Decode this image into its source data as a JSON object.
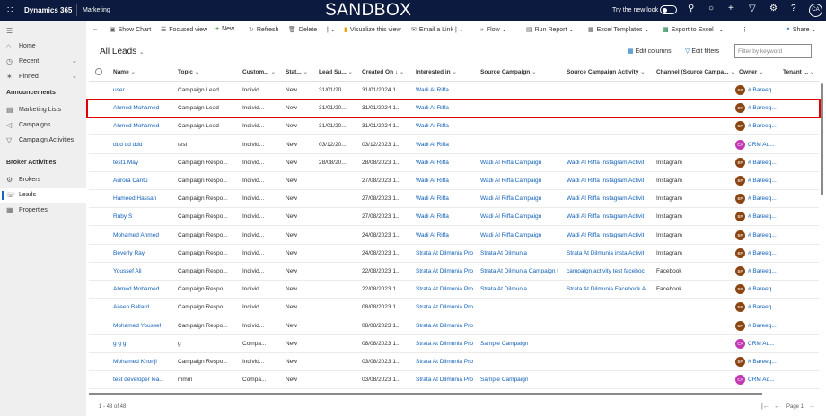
{
  "topbar": {
    "brand": "Dynamics 365",
    "app": "Marketing",
    "environment": "SANDBOX",
    "new_look_label": "Try the new look",
    "new_look_on": false,
    "user_initials": "CA",
    "bg_color": "#0b1a3e"
  },
  "sidebar": {
    "top_items": [
      {
        "label": "Home",
        "icon": "home-icon"
      },
      {
        "label": "Recent",
        "icon": "clock-icon"
      },
      {
        "label": "Pinned",
        "icon": "pin-icon"
      }
    ],
    "groups": [
      {
        "title": "Announcements",
        "items": [
          {
            "label": "Marketing Lists"
          },
          {
            "label": "Campaigns"
          },
          {
            "label": "Campaign Activities"
          }
        ]
      },
      {
        "title": "Broker Activities",
        "items": [
          {
            "label": "Brokers"
          },
          {
            "label": "Leads",
            "active": true
          },
          {
            "label": "Properties"
          }
        ]
      }
    ]
  },
  "commands": {
    "show_chart": "Show Chart",
    "focused_view": "Focused view",
    "new": "New",
    "refresh": "Refresh",
    "delete": "Delete",
    "visualize": "Visualize this view",
    "email_link": "Email a Link",
    "flow": "Flow",
    "run_report": "Run Report",
    "excel_templates": "Excel Templates",
    "export_excel": "Export to Excel",
    "share": "Share"
  },
  "view": {
    "title": "All Leads",
    "edit_columns": "Edit columns",
    "edit_filters": "Edit filters",
    "filter_placeholder": "Filter by keyword"
  },
  "columns": [
    "Name",
    "Topic",
    "Custom...",
    "Stat...",
    "Lead Su...",
    "Created On",
    "Interested in",
    "Source Campaign",
    "Source Campaign Activity",
    "Channel (Source Campa...",
    "Owner",
    "Tenant ..."
  ],
  "rows": [
    {
      "name": "user",
      "topic": "Campaign Lead",
      "customer": "Individ...",
      "status": "New",
      "lead_source": "31/01/20...",
      "created": "31/01/2024 1...",
      "interested": "Wadi Al Riffa",
      "campaign": "",
      "activity": "",
      "channel": "",
      "owner_initials": "BP",
      "owner": "# Bareeq..."
    },
    {
      "name": "Ahmed Mohamed",
      "topic": "Campaign Lead",
      "customer": "Individ...",
      "status": "New",
      "lead_source": "31/01/20...",
      "created": "31/01/2024 1...",
      "interested": "Wadi Al Riffa",
      "campaign": "",
      "activity": "",
      "channel": "",
      "owner_initials": "BP",
      "owner": "# Bareeq...",
      "highlighted": true
    },
    {
      "name": "Ahmed Mohamed",
      "topic": "Campaign Lead",
      "customer": "Individ...",
      "status": "New",
      "lead_source": "31/01/20...",
      "created": "31/01/2024 1...",
      "interested": "Wadi Al Riffa",
      "campaign": "",
      "activity": "",
      "channel": "",
      "owner_initials": "BP",
      "owner": "# Bareeq..."
    },
    {
      "name": "ddd dd ddd",
      "topic": "test",
      "customer": "Individ...",
      "status": "New",
      "lead_source": "03/12/20...",
      "created": "03/12/2023 1...",
      "interested": "Wadi Al Riffa",
      "campaign": "",
      "activity": "",
      "channel": "",
      "owner_initials": "CA",
      "owner": "CRM Ad..."
    },
    {
      "name": "test1 May",
      "topic": "Campaign Respo...",
      "customer": "Individ...",
      "status": "New",
      "lead_source": "28/08/20...",
      "created": "28/08/2023 1...",
      "interested": "Wadi Al Riffa",
      "campaign": "Wadi Al Riffa Campaign",
      "activity": "Wadi Al Riffa Instagram Activit",
      "channel": "Instagram",
      "owner_initials": "BP",
      "owner": "# Bareeq..."
    },
    {
      "name": "Aurora Cantu",
      "topic": "Campaign Respo...",
      "customer": "Individ...",
      "status": "New",
      "lead_source": "",
      "created": "27/08/2023 1...",
      "interested": "Wadi Al Riffa",
      "campaign": "Wadi Al Riffa Campaign",
      "activity": "Wadi Al Riffa Instagram Activit",
      "channel": "Instagram",
      "owner_initials": "BP",
      "owner": "# Bareeq..."
    },
    {
      "name": "Hameed Hassan",
      "topic": "Campaign Respo...",
      "customer": "Individ...",
      "status": "New",
      "lead_source": "",
      "created": "27/08/2023 1...",
      "interested": "Wadi Al Riffa",
      "campaign": "Wadi Al Riffa Campaign",
      "activity": "Wadi Al Riffa Instagram Activit",
      "channel": "Instagram",
      "owner_initials": "BP",
      "owner": "# Bareeq..."
    },
    {
      "name": "Ruby S",
      "topic": "Campaign Respo...",
      "customer": "Individ...",
      "status": "New",
      "lead_source": "",
      "created": "27/08/2023 1...",
      "interested": "Wadi Al Riffa",
      "campaign": "Wadi Al Riffa Campaign",
      "activity": "Wadi Al Riffa Instagram Activit",
      "channel": "Instagram",
      "owner_initials": "BP",
      "owner": "# Bareeq..."
    },
    {
      "name": "Mohamed Ahmed",
      "topic": "Campaign Respo...",
      "customer": "Individ...",
      "status": "New",
      "lead_source": "",
      "created": "24/08/2023 1...",
      "interested": "Wadi Al Riffa",
      "campaign": "Wadi Al Riffa Campaign",
      "activity": "Wadi Al Riffa Instagram Activit",
      "channel": "Instagram",
      "owner_initials": "BP",
      "owner": "# Bareeq..."
    },
    {
      "name": "Beverly Ray",
      "topic": "Campaign Respo...",
      "customer": "Individ...",
      "status": "New",
      "lead_source": "",
      "created": "24/08/2023 1...",
      "interested": "Strata At Dilmunia Pro",
      "campaign": "Strata At Dilmunia",
      "activity": "Strata At Dilmunia insta Activit",
      "channel": "Instagram",
      "owner_initials": "BP",
      "owner": "# Bareeq..."
    },
    {
      "name": "Youssef Ali",
      "topic": "Campaign Respo...",
      "customer": "Individ...",
      "status": "New",
      "lead_source": "",
      "created": "22/08/2023 1...",
      "interested": "Strata At Dilmunia Pro",
      "campaign": "Strata At Dilmunia Campaign t",
      "activity": "campaign activity test faceboc",
      "channel": "Facebook",
      "owner_initials": "BP",
      "owner": "# Bareeq..."
    },
    {
      "name": "Ahmed Mohamed",
      "topic": "Campaign Respo...",
      "customer": "Individ...",
      "status": "New",
      "lead_source": "",
      "created": "22/08/2023 1...",
      "interested": "Strata At Dilmunia Pro",
      "campaign": "Strata At Dilmunia",
      "activity": "Strata At Dilmunia Facebook A",
      "channel": "Facebook",
      "owner_initials": "BP",
      "owner": "# Bareeq..."
    },
    {
      "name": "Aileen Ballard",
      "topic": "Campaign Respo...",
      "customer": "Individ...",
      "status": "New",
      "lead_source": "",
      "created": "08/08/2023 1...",
      "interested": "Strata At Dilmunia Pro",
      "campaign": "",
      "activity": "",
      "channel": "",
      "owner_initials": "BP",
      "owner": "# Bareeq..."
    },
    {
      "name": "Mohamed Youssef",
      "topic": "Campaign Respo...",
      "customer": "Individ...",
      "status": "New",
      "lead_source": "",
      "created": "08/08/2023 1...",
      "interested": "Strata At Dilmunia Pro",
      "campaign": "",
      "activity": "",
      "channel": "",
      "owner_initials": "BP",
      "owner": "# Bareeq..."
    },
    {
      "name": "g g g",
      "topic": "g",
      "customer": "Compa...",
      "status": "New",
      "lead_source": "",
      "created": "08/08/2023 1...",
      "interested": "Strata At Dilmunia Pro",
      "campaign": "Sample Campaign",
      "activity": "",
      "channel": "",
      "owner_initials": "CA",
      "owner": "CRM Ad..."
    },
    {
      "name": "Mohamed Khonji",
      "topic": "Campaign Respo...",
      "customer": "Individ...",
      "status": "New",
      "lead_source": "",
      "created": "03/08/2023 1...",
      "interested": "Strata At Dilmunia Pro",
      "campaign": "",
      "activity": "",
      "channel": "",
      "owner_initials": "BP",
      "owner": "# Bareeq..."
    },
    {
      "name": "test developer lea...",
      "topic": "mmm",
      "customer": "Compa...",
      "status": "New",
      "lead_source": "",
      "created": "03/08/2023 1...",
      "interested": "Strata At Dilmunia Pro",
      "campaign": "Sample Campaign",
      "activity": "",
      "channel": "",
      "owner_initials": "CA",
      "owner": "CRM Ad..."
    }
  ],
  "footer": {
    "count": "1 - 48 of 48",
    "page": "Page 1"
  },
  "colors": {
    "link": "#1160b7",
    "highlight_border": "#e00000",
    "owner_bp": "#8b4513",
    "owner_ca": "#c239b3"
  }
}
